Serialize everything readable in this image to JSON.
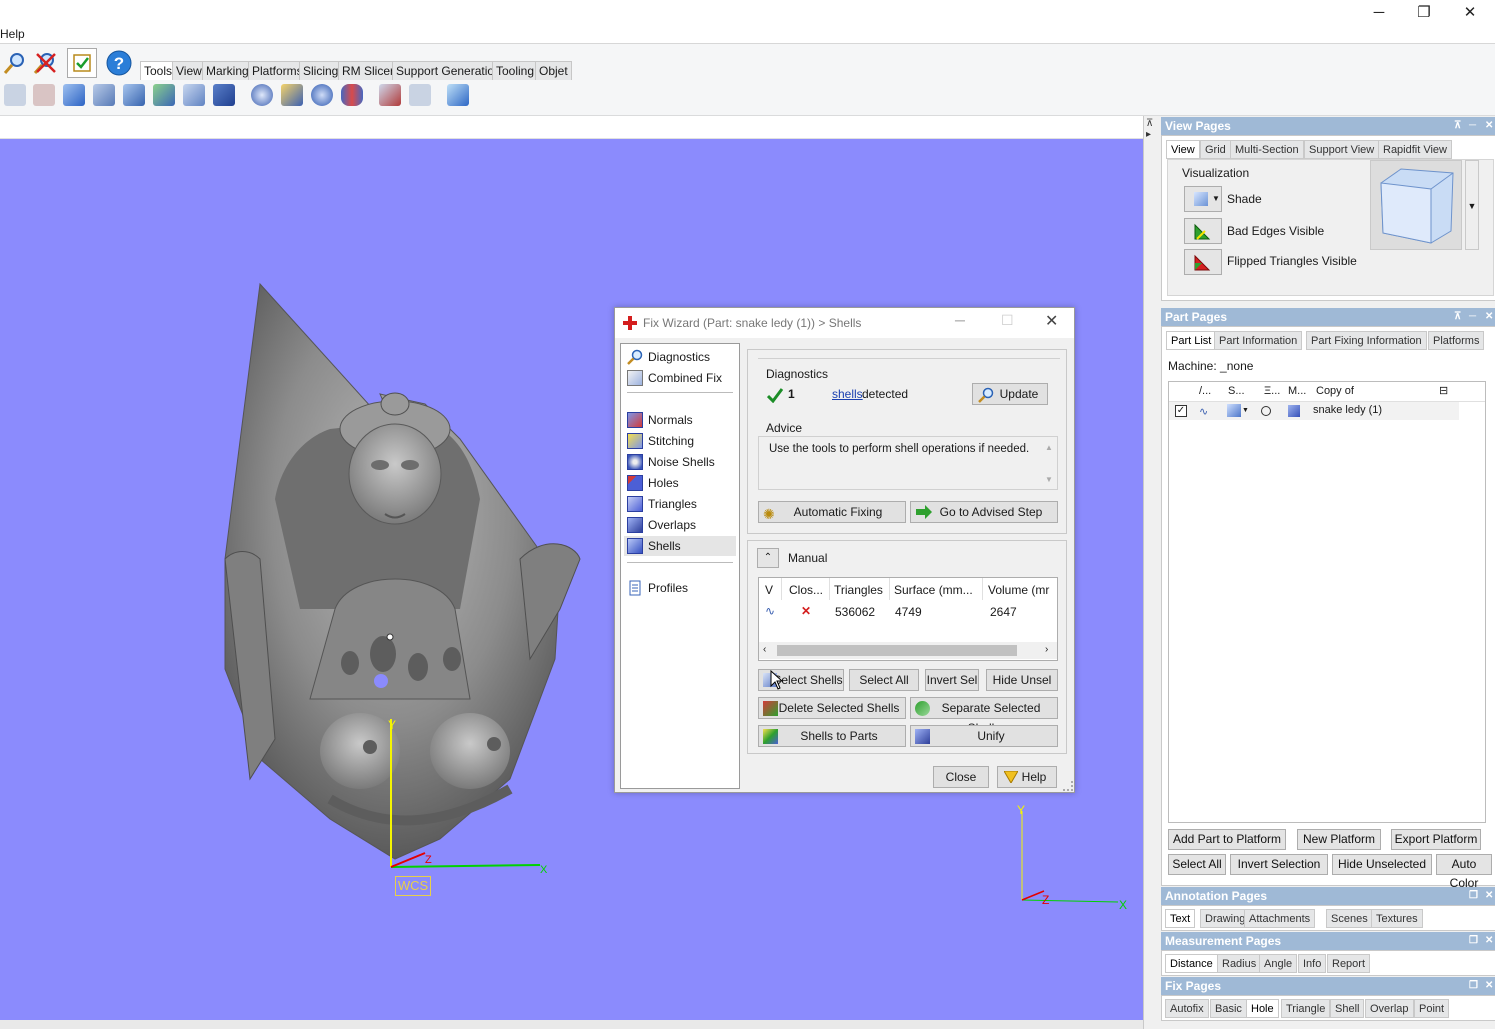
{
  "menu": {
    "help": "Help"
  },
  "window_controls": {
    "minimize": "─",
    "restore": "❐",
    "close": "✕"
  },
  "ribbon": {
    "tabs": [
      "Tools",
      "View",
      "Marking",
      "Platforms",
      "Slicing",
      "RM Slicer",
      "Support Generation",
      "Tooling",
      "Objet"
    ],
    "active_tab": "Tools"
  },
  "viewport": {
    "wcs_label": "WCS",
    "axis_x": "X",
    "axis_y": "Y",
    "axis_z": "Z"
  },
  "view_pages": {
    "title": "View Pages",
    "tabs": [
      "View",
      "Grid",
      "Multi-Section",
      "Support View",
      "Rapidfit View"
    ],
    "group": "Visualization",
    "items": [
      "Shade",
      "Bad Edges Visible",
      "Flipped Triangles Visible"
    ]
  },
  "part_pages": {
    "title": "Part Pages",
    "tabs": [
      "Part List",
      "Part Information",
      "Part Fixing Information",
      "Platforms"
    ],
    "machine_label": "Machine:",
    "machine_value": "_none",
    "columns": [
      "/...",
      "S...",
      "Ξ...",
      "M...",
      "Copy of"
    ],
    "row_name": "snake ledy  (1)",
    "buttons_row1": [
      "Add Part to Platform",
      "New Platform",
      "Export Platform"
    ],
    "buttons_row2": [
      "Select All",
      "Invert Selection",
      "Hide Unselected",
      "Auto Color"
    ]
  },
  "annotation_pages": {
    "title": "Annotation Pages",
    "tabs": [
      "Text",
      "Drawing",
      "Attachments",
      "Scenes",
      "Textures"
    ]
  },
  "measurement_pages": {
    "title": "Measurement Pages",
    "tabs": [
      "Distance",
      "Radius",
      "Angle",
      "Info",
      "Report"
    ]
  },
  "fix_pages": {
    "title": "Fix Pages",
    "tabs": [
      "Autofix",
      "Basic",
      "Hole",
      "Triangle",
      "Shell",
      "Overlap",
      "Point"
    ]
  },
  "dialog": {
    "title": "Fix Wizard (Part: snake ledy  (1)) > Shells",
    "nav": [
      "Diagnostics",
      "Combined Fix",
      "Normals",
      "Stitching",
      "Noise Shells",
      "Holes",
      "Triangles",
      "Overlaps",
      "Shells",
      "Profiles"
    ],
    "active_nav": "Shells",
    "diagnostics": {
      "label": "Diagnostics",
      "count": "1",
      "link": "shells",
      "suffix": "detected",
      "update": "Update"
    },
    "advice": {
      "label": "Advice",
      "text": "Use the tools to perform shell operations if needed."
    },
    "automatic_fixing": "Automatic Fixing",
    "go_to_advised": "Go to Advised Step",
    "manual_label": "Manual",
    "table": {
      "headers": [
        "V",
        "Clos...",
        "Triangles",
        "Surface (mm...",
        "Volume (mr"
      ],
      "row": {
        "triangles": "536062",
        "surface": "4749",
        "volume": "2647"
      }
    },
    "buttons": {
      "select_shells": "Select Shells",
      "select_all": "Select All",
      "invert_sel": "Invert Sel",
      "hide_unsel": "Hide Unsel",
      "delete_selected": "Delete Selected Shells",
      "separate_selected": "Separate Selected Shells",
      "shells_to_parts": "Shells to Parts",
      "unify": "Unify",
      "close": "Close",
      "help": "Help"
    }
  },
  "colors": {
    "viewport_bg": "#8b8bfd",
    "dock_header": "#9fb9d6",
    "wcs_border": "#e8d04a"
  }
}
